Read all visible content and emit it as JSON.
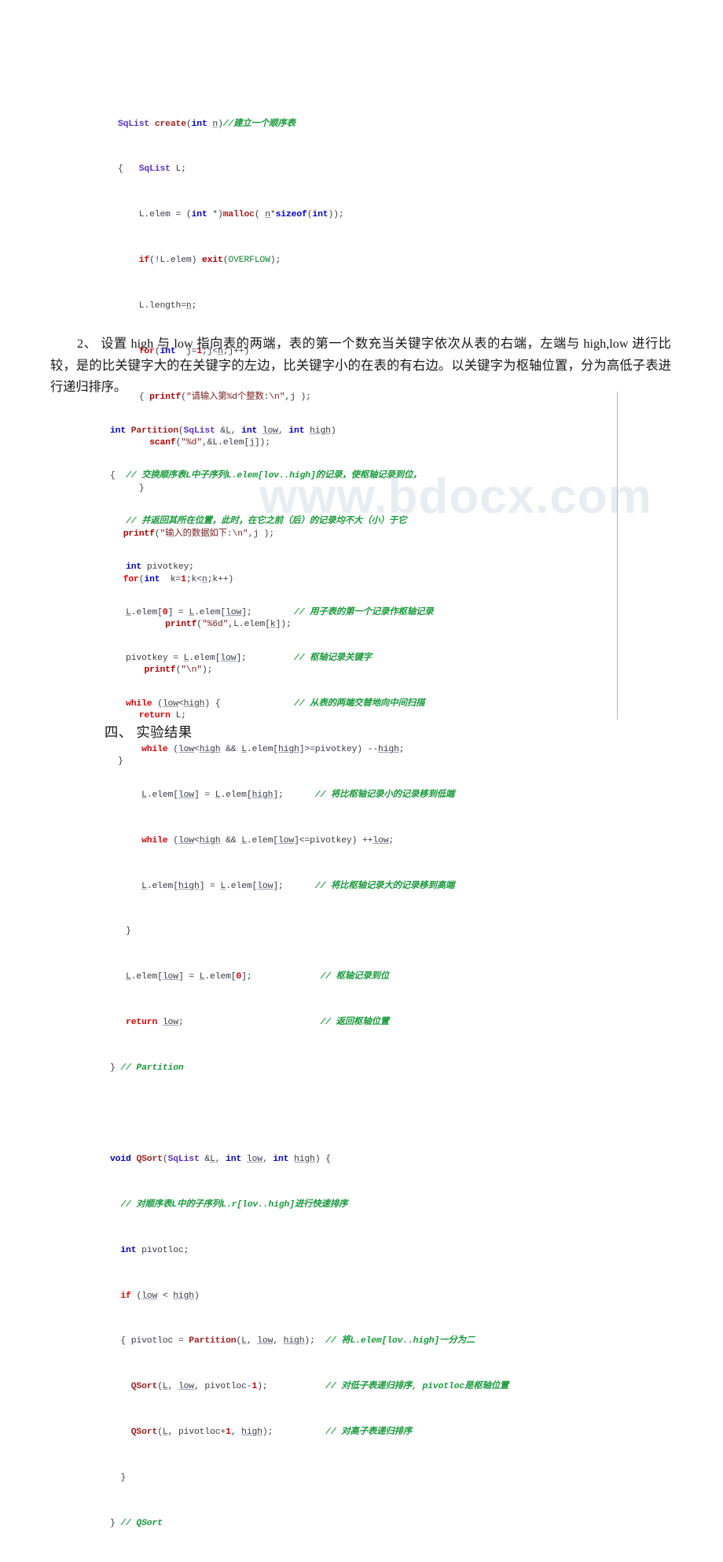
{
  "document": {
    "watermark": "www.bdocx.com",
    "section_heading": "四、 实验结果",
    "paragraph_2": "2、 设置 high 与 low 指向表的两端，表的第一个数充当关键字依次从表的右端，左端与 high,low 进行比较，是的比关键字大的在关键字的左边，比关键字小的在表的有右边。以关键字为枢轴位置，分为高低子表进行递归排序。"
  },
  "code_block_1": {
    "title": "create",
    "lines": [
      "SqList create(int n)//建立一个顺序表",
      "{   SqList L;",
      "    L.elem = (int *)malloc( n*sizeof(int));",
      "    if(!L.elem) exit(OVERFLOW);",
      "    L.length=n;",
      "    for(int  j=1;j<n;j++)",
      "    { printf(\"请输入第%d个整数:\\n\",j );",
      "      scanf(\"%d\",&L.elem[j]);",
      "    }",
      " printf(\"输入的数据如下:\\n\",j );",
      " for(int  k=1;k<n;k++)",
      "         printf(\"%6d\",L.elem[k]);",
      "     printf(\"\\n\");",
      "    return L;",
      "}"
    ]
  },
  "code_block_2": {
    "title": "Partition / QSort",
    "lines": [
      "int Partition(SqList &L, int low, int high)",
      "{  // 交换顺序表L中子序列L.elem[lov..high]的记录，使枢轴记录到位，",
      "   // 并返回其所在位置，此时，在它之前（后）的记录均不大（小）于它",
      "   int pivotkey;",
      "   L.elem[0] = L.elem[low];        // 用子表的第一个记录作枢轴记录",
      "   pivotkey = L.elem[low];         // 枢轴记录关键字",
      "   while (low<high) {              // 从表的两端交替地向中间扫描",
      "      while (low<high && L.elem[high]>=pivotkey) --high;",
      "      L.elem[low] = L.elem[high];      // 将比枢轴记录小的记录移到低端",
      "      while (low<high && L.elem[low]<=pivotkey) ++low;",
      "      L.elem[high] = L.elem[low];      // 将比枢轴记录大的记录移到高端",
      "   }",
      "   L.elem[low] = L.elem[0];             // 枢轴记录到位",
      "   return low;                          // 返回枢轴位置",
      "} // Partition",
      "",
      "void QSort(SqList &L, int low, int high) {",
      "  // 对顺序表L中的子序列L.r[lov..high]进行快速排序",
      "  int pivotloc;",
      "  if (low < high)",
      "  { pivotloc = Partition(L, low, high);  // 将L.elem[lov..high]一分为二",
      "    QSort(L, low, pivotloc-1);           // 对低子表递归排序, pivotloc是枢轴位置",
      "    QSort(L, pivotloc+1, high);          // 对高子表递归排序",
      "  }",
      "} // QSort"
    ]
  },
  "colors": {
    "keyword": "#0000c8",
    "control_keyword": "#e00000",
    "type": "#5a32c8",
    "function": "#a02020",
    "string": "#7a2020",
    "number": "#d00000",
    "comment": "#1a9a3c",
    "plain": "#3a3a4a",
    "rule": "#b9b9b9",
    "text": "#161616"
  }
}
